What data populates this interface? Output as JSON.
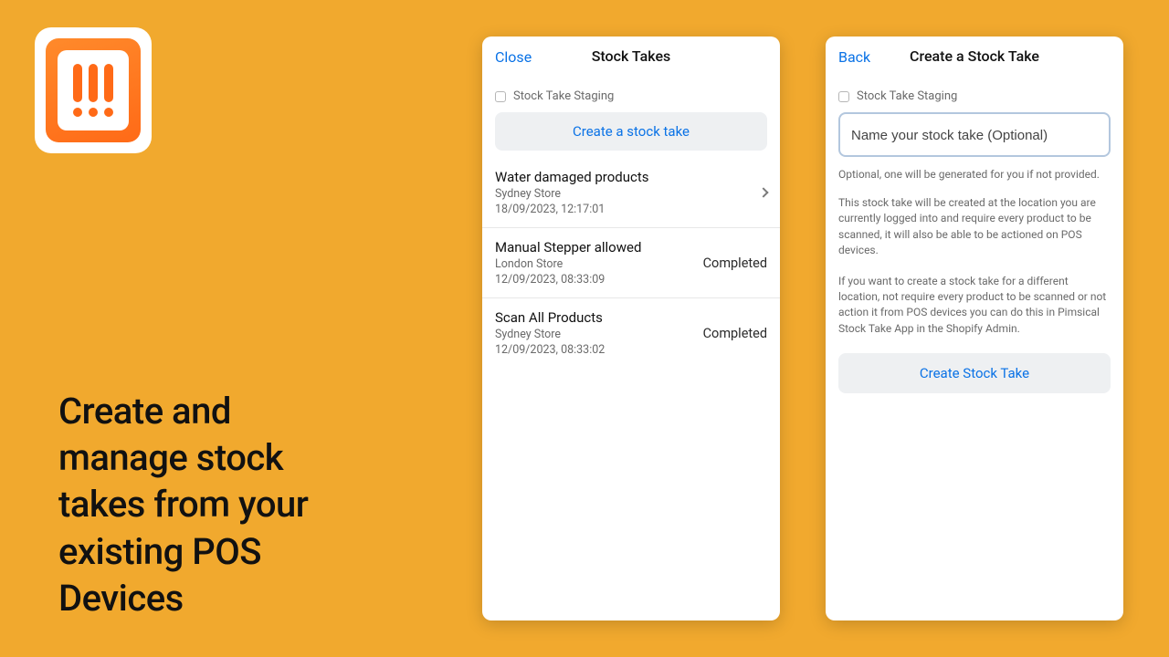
{
  "hero_text": "Create and manage stock takes from your existing POS Devices",
  "phone1": {
    "back_label": "Close",
    "title": "Stock Takes",
    "staging_label": "Stock Take Staging",
    "create_button": "Create a stock take",
    "rows": [
      {
        "title": "Water damaged products",
        "store": "Sydney Store",
        "datetime": "18/09/2023, 12:17:01",
        "status": ""
      },
      {
        "title": "Manual Stepper allowed",
        "store": "London Store",
        "datetime": "12/09/2023, 08:33:09",
        "status": "Completed"
      },
      {
        "title": "Scan All Products",
        "store": "Sydney Store",
        "datetime": "12/09/2023, 08:33:02",
        "status": "Completed"
      }
    ]
  },
  "phone2": {
    "back_label": "Back",
    "title": "Create a Stock Take",
    "staging_label": "Stock Take Staging",
    "name_placeholder": "Name your stock take (Optional)",
    "hint": "Optional, one will be generated for you if not provided.",
    "para1": "This stock take will be created at the location you are currently logged into and require every product to be scanned, it will also be able to be actioned on POS devices.",
    "para2": "If you want to create a stock take for a different location, not require every product to be scanned or not action it from POS devices you can do this in Pimsical Stock Take App in the Shopify Admin.",
    "create_button": "Create Stock Take"
  }
}
